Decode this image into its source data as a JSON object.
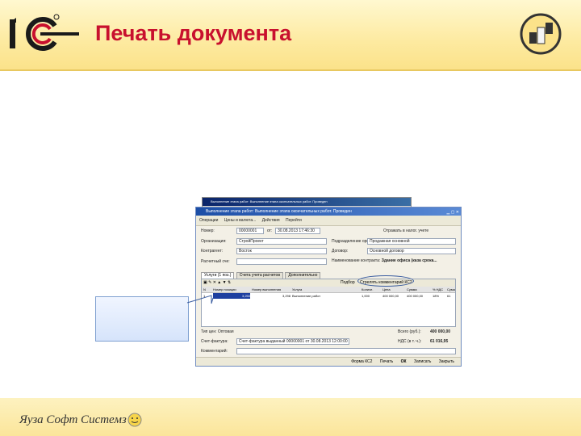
{
  "slide": {
    "title": "Печать документа",
    "footer": "Яуза Софт Системз",
    "colors": {
      "title": "#c8102e",
      "band": "#fbe28a"
    }
  },
  "back_window": {
    "caption": "Выполнение этапа работ: Выполнение этапа окончательных работ. Проведен"
  },
  "window": {
    "caption": "Выполнение этапа работ: Выполнение этапа окончательных работ. Проведен",
    "toolbar": [
      "Операции",
      "Цены и валюта...",
      "Действия",
      "Перейти"
    ],
    "labels": {
      "number": "Номер:",
      "from": "от:",
      "organization": "Организация:",
      "counterparty": "Контрагент:",
      "payment_account": "Расчетный сче:",
      "department": "Подразделение организации:",
      "contract": "Договор:",
      "contract_name": "Наименование контракта:",
      "account": "Отражать в налог. учете"
    },
    "values": {
      "number": "00000001",
      "date": "30.08.2013 17:46:30",
      "organization": "СтройПроект",
      "counterparty": "Восток",
      "department": "Продажная основной",
      "contract": "Основной договор",
      "contract_name": "Здание офиса (каза срока..."
    },
    "tabs": [
      "Услуги (1 поз.)",
      "Счета учета расчетов",
      "Дополнительно"
    ],
    "grid_toolbar_hint": "Подбор",
    "grid_highlight": "Стрелять комментарий КС2",
    "grid_headers": [
      "N",
      "Номер позиции",
      "Номер выполнения",
      "Услуга",
      "Количе.",
      "Цена",
      "Сумма",
      "% НДС",
      "Сума"
    ],
    "grid_row": [
      "1",
      "3,250",
      "3,298",
      "Выполнение работ",
      "1,000",
      "400 000,00",
      "400 000,00",
      "18%",
      "61"
    ],
    "bottom": {
      "type_label": "Тип цен: Оптовая",
      "total_label": "Всего (руб.):",
      "total_value": "400 000,00",
      "invoice_label": "Счет-фактура:",
      "invoice_value": "Счет-фактура выданный 00000001 от 30.08.2013 12:00:00",
      "vat_label": "НДС (в т. ч.):",
      "vat_value": "61 016,95",
      "comment_label": "Комментарий:"
    },
    "status": [
      "Форма КС2",
      "Печать",
      "ОК",
      "Записать",
      "Закрыть"
    ]
  }
}
